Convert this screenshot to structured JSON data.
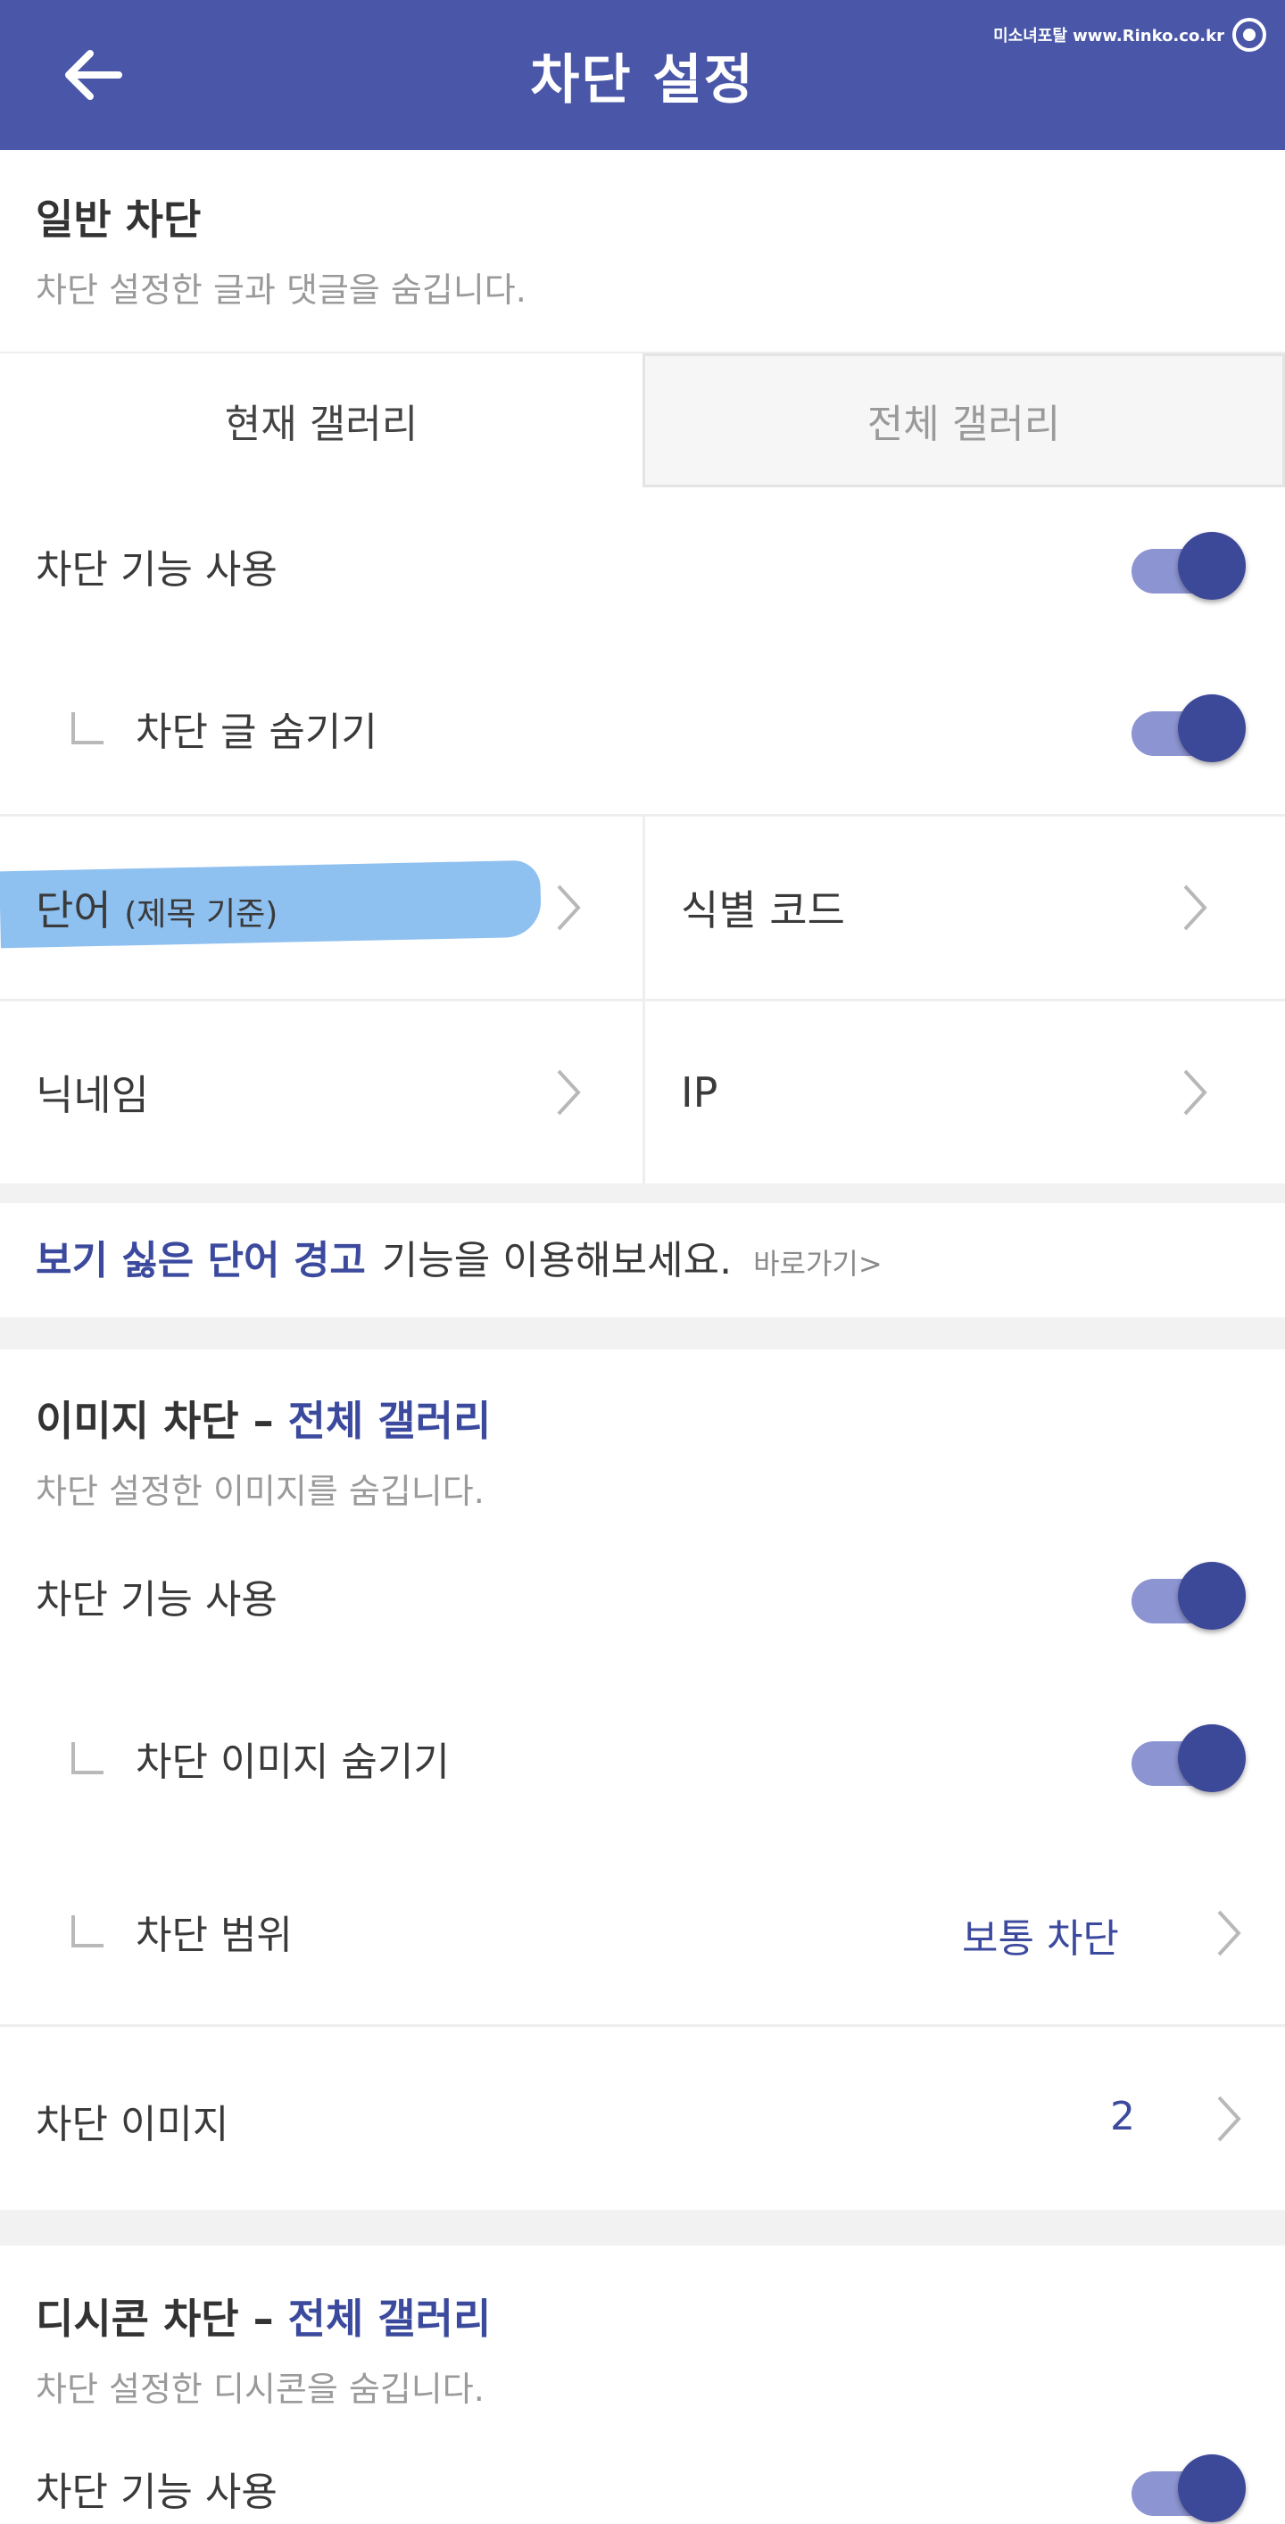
{
  "header": {
    "title": "차단 설정",
    "watermark": "미소녀포탈 www.Rinko.co.kr"
  },
  "general": {
    "title": "일반 차단",
    "desc": "차단 설정한 글과 댓글을 숨깁니다.",
    "tabs": [
      "현재 갤러리",
      "전체 갤러리"
    ],
    "toggle_label": "차단 기능 사용",
    "toggle_on": true,
    "sub_label": "차단 글 숨기기",
    "sub_on": true,
    "cells": {
      "word": "단어",
      "word_note": "(제목 기준)",
      "code": "식별 코드",
      "nickname": "닉네임",
      "ip": "IP"
    }
  },
  "promo": {
    "strong": "보기 싫은 단어 경고",
    "rest": "기능을 이용해보세요.",
    "link": "바로가기>"
  },
  "image": {
    "title": "이미지 차단",
    "dash": "–",
    "scope": "전체 갤러리",
    "desc": "차단 설정한 이미지를 숨깁니다.",
    "toggle_label": "차단 기능 사용",
    "toggle_on": true,
    "sub_label": "차단 이미지 숨기기",
    "sub_on": true,
    "range_label": "차단 범위",
    "range_value": "보통 차단",
    "blocked_label": "차단 이미지",
    "blocked_count": "2"
  },
  "dccon": {
    "title": "디시콘 차단",
    "dash": "–",
    "scope": "전체 갤러리",
    "desc": "차단 설정한 디시콘을 숨깁니다.",
    "toggle_label": "차단 기능 사용",
    "toggle_on": true
  },
  "colors": {
    "header": "#4a57a8",
    "accent": "#3c4a9e",
    "toggle_track": "#8c94d2",
    "toggle_knob": "#3c4898",
    "highlight": "#8ec0f0"
  }
}
